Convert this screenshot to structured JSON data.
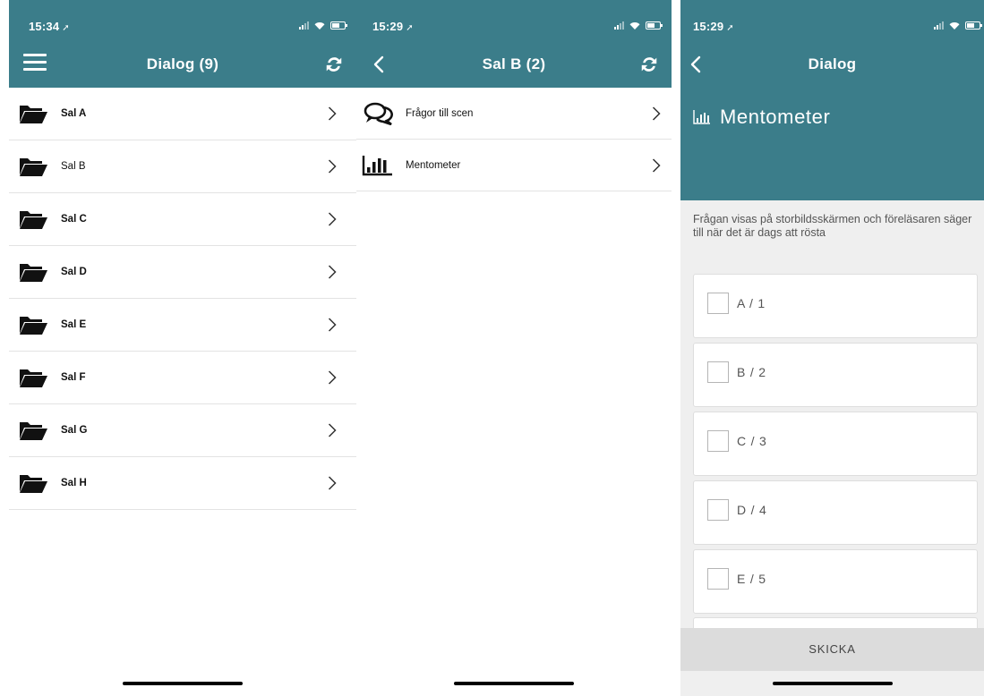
{
  "screens": [
    {
      "status": {
        "time": "15:34"
      },
      "nav": {
        "title": "Dialog (9)",
        "left_icon": "menu-icon",
        "right_icon": "refresh-icon"
      },
      "rows": [
        {
          "label": "Sal A",
          "bold": true
        },
        {
          "label": "Sal B",
          "bold": false
        },
        {
          "label": "Sal C",
          "bold": true
        },
        {
          "label": "Sal D",
          "bold": true
        },
        {
          "label": "Sal E",
          "bold": true
        },
        {
          "label": "Sal F",
          "bold": true
        },
        {
          "label": "Sal G",
          "bold": true
        },
        {
          "label": "Sal H",
          "bold": true
        }
      ]
    },
    {
      "status": {
        "time": "15:29"
      },
      "nav": {
        "title": "Sal B (2)",
        "left_icon": "back-icon",
        "right_icon": "refresh-icon"
      },
      "rows": [
        {
          "label": "Frågor till scen",
          "icon": "chat-bubbles-icon"
        },
        {
          "label": "Mentometer",
          "icon": "bar-chart-icon"
        }
      ]
    },
    {
      "status": {
        "time": "15:29"
      },
      "nav": {
        "title": "Dialog",
        "left_icon": "back-icon"
      },
      "heading": "Mentometer",
      "instructions": "Frågan visas på storbildsskärmen och föreläsaren säger till när det är dags att rösta",
      "options": [
        "A / 1",
        "B / 2",
        "C / 3",
        "D / 4",
        "E / 5"
      ],
      "submit": "SKICKA"
    }
  ],
  "colors": {
    "header": "#3b7d8a",
    "text": "#111111",
    "muted": "#555555",
    "divider": "#e3e3e3"
  }
}
